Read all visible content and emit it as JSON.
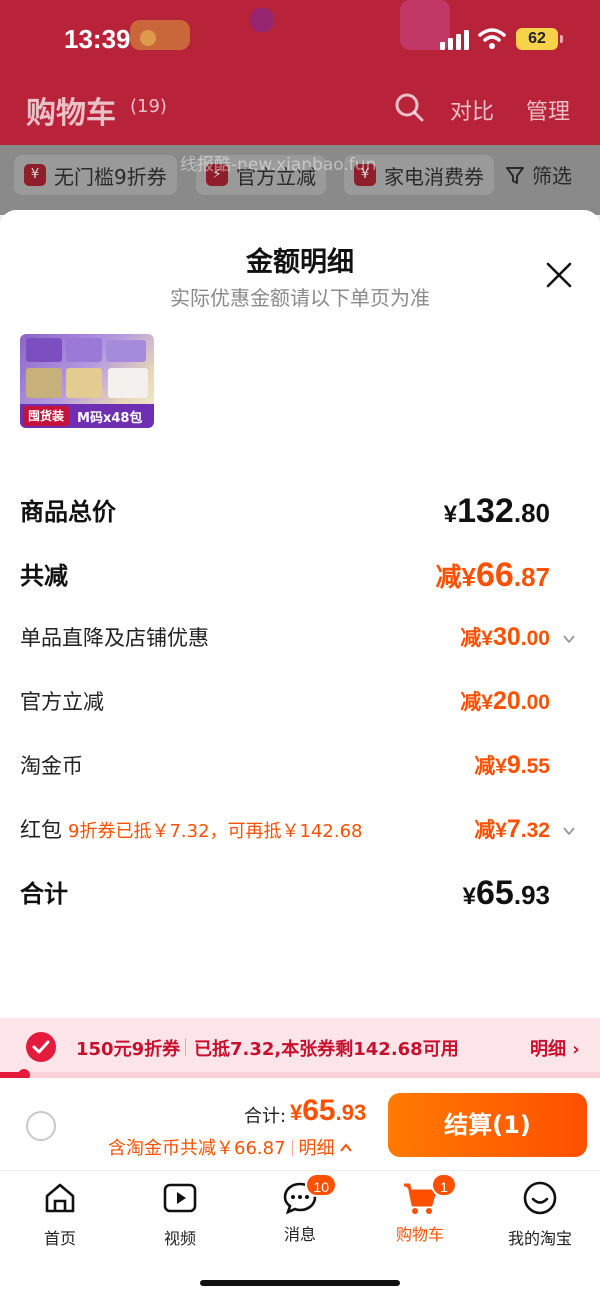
{
  "status_bar": {
    "time": "13:39",
    "battery": "62"
  },
  "header": {
    "title": "购物车",
    "count": "(19)",
    "compare": "对比",
    "manage": "管理"
  },
  "filters": {
    "chips": [
      "无门槛9折券",
      "官方立减",
      "家电消费券"
    ],
    "chip_icon_glyph": "¥",
    "filter_label": "筛选"
  },
  "watermark": "线报酷-new.xianbao.fun",
  "sheet": {
    "title": "金额明细",
    "subtitle": "实际优惠金额请以下单页为准",
    "product_badges": [
      "囤货装",
      "M码x48包"
    ],
    "rows": [
      {
        "label": "商品总价",
        "prefix": "¥",
        "int": "132",
        "dec": ".80"
      },
      {
        "label": "共减",
        "prefix": "减¥",
        "int": "66",
        "dec": ".87"
      },
      {
        "label": "单品直降及店铺优惠",
        "prefix": "减¥",
        "int": "30",
        "dec": ".00"
      },
      {
        "label": "官方立减",
        "prefix": "减¥",
        "int": "20",
        "dec": ".00"
      },
      {
        "label": "淘金币",
        "prefix": "减¥",
        "int": "9",
        "dec": ".55"
      },
      {
        "label": "红包",
        "note": "9折券已抵￥7.32，可再抵￥142.68",
        "prefix": "减¥",
        "int": "7",
        "dec": ".32"
      },
      {
        "label": "合计",
        "prefix": "¥",
        "int": "65",
        "dec": ".93"
      }
    ]
  },
  "coupon": {
    "name": "150元9折券",
    "desc": "已抵7.32,本张券剩142.68可用",
    "detail": "明细 ›",
    "used_fraction": 0.04
  },
  "checkout": {
    "total_label": "合计:",
    "total_prefix": "¥",
    "total_int": "65",
    "total_dec": ".93",
    "savings": "含淘金币共减￥66.87",
    "savings_detail": "明细",
    "pay_label": "结算(1)"
  },
  "tabs": [
    {
      "label": "首页",
      "icon": "home-icon"
    },
    {
      "label": "视频",
      "icon": "video-icon"
    },
    {
      "label": "消息",
      "icon": "message-icon",
      "badge": "10"
    },
    {
      "label": "购物车",
      "icon": "cart-icon",
      "badge": "1",
      "active": true
    },
    {
      "label": "我的淘宝",
      "icon": "profile-icon"
    }
  ],
  "colors": {
    "accent": "#ff5000",
    "brand_red": "#e41b3c",
    "header_bg": "#b8233a"
  }
}
